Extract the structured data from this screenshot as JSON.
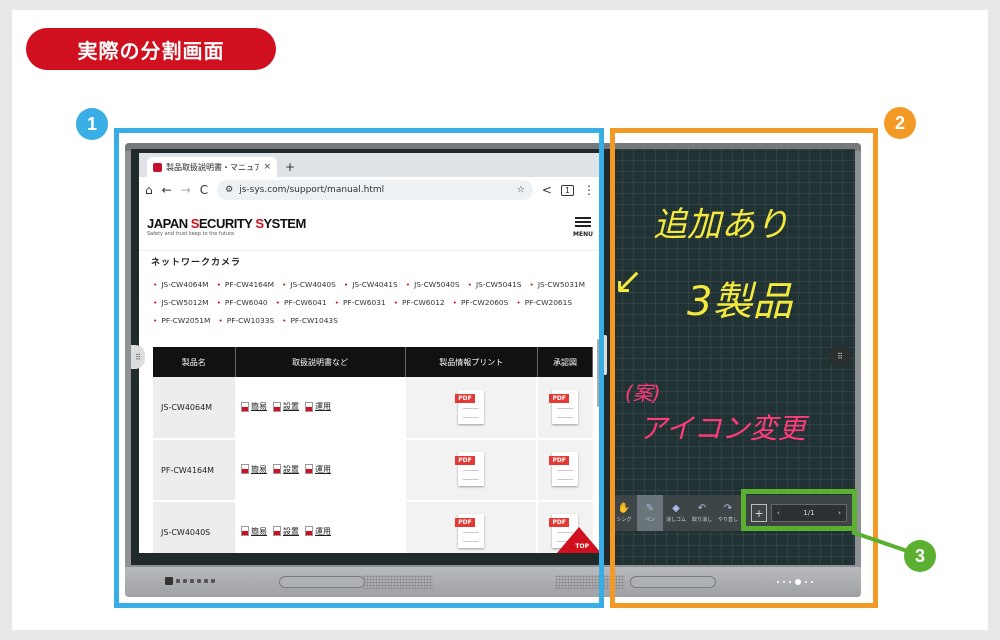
{
  "banner": {
    "title": "実際の分割画面"
  },
  "callouts": {
    "one": "1",
    "two": "2",
    "three": "3"
  },
  "colors": {
    "brand_red": "#d0101e",
    "frame_blue": "#39aee6",
    "frame_orange": "#f39a26",
    "frame_green": "#5cb031",
    "ink_yellow": "#f3ea3d",
    "ink_pink": "#ff3b7a"
  },
  "browser": {
    "tab": {
      "title": "製品取扱説明書・マニュア",
      "close": "×",
      "add": "+"
    },
    "nav": {
      "back": "←",
      "forward": "→",
      "reload": "C",
      "home": "⌂"
    },
    "url": "js-sys.com/support/manual.html",
    "tab_count": "1",
    "icons": {
      "star": "star-icon",
      "share": "share-icon",
      "more": "more-icon",
      "site-settings": "tune-icon"
    }
  },
  "site": {
    "logo": {
      "part1": "JAPAN ",
      "red1": "S",
      "part2": "ECURITY ",
      "red2": "S",
      "part3": "YSTEM",
      "tagline": "Safety and trust keep to the future"
    },
    "menu_label": "MENU",
    "section_heading": "ネットワークカメラ",
    "models": [
      "JS-CW4064M",
      "PF-CW4164M",
      "JS-CW4040S",
      "JS-CW4041S",
      "JS-CW5040S",
      "JS-CW5041S",
      "JS-CW5031M",
      "JS-CW5012M",
      "PF-CW6040",
      "PF-CW6041",
      "PF-CW6031",
      "PF-CW6012",
      "PF-CW2060S",
      "PF-CW2061S",
      "PF-CW2051M",
      "PF-CW1033S",
      "PF-CW1043S"
    ],
    "table": {
      "headers": [
        "製品名",
        "取扱説明書など",
        "製品情報プリント",
        "承認図"
      ],
      "doc_labels": [
        "簡易",
        "設置",
        "運用"
      ],
      "pdf_label": "PDF",
      "rows": [
        {
          "model": "JS-CW4064M"
        },
        {
          "model": "PF-CW4164M"
        },
        {
          "model": "JS-CW4040S"
        }
      ]
    },
    "top_button": "TOP"
  },
  "whiteboard": {
    "notes": {
      "line1": "追加あり",
      "line2": "3製品",
      "line3": "(案)",
      "line4": "アイコン変更",
      "arrow": "↙"
    },
    "tools": [
      {
        "icon": "✋",
        "label": "シング",
        "name": "touch-tool"
      },
      {
        "icon": "✎",
        "label": "ペン",
        "name": "pen-tool",
        "active": true
      },
      {
        "icon": "◆",
        "label": "消しゴム",
        "name": "eraser-tool"
      },
      {
        "icon": "↶",
        "label": "取り消し",
        "name": "undo-tool"
      },
      {
        "icon": "↷",
        "label": "やり直し",
        "name": "redo-tool"
      }
    ],
    "pager": {
      "add": "+",
      "prev": "‹",
      "current": "1/1",
      "next": "›"
    },
    "side_handle": "⠿"
  }
}
